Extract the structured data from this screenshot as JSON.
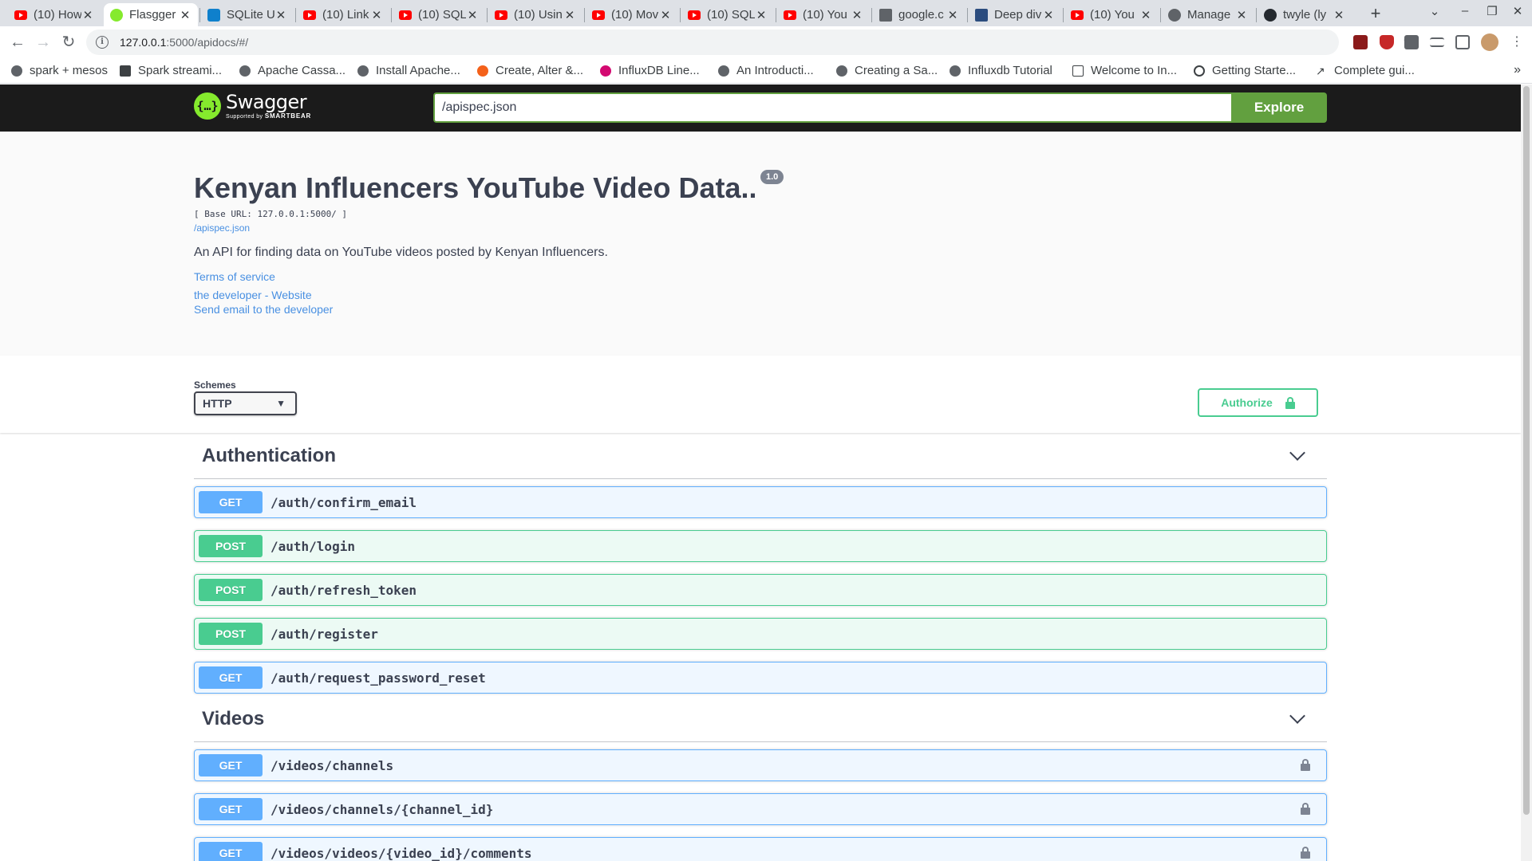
{
  "browser": {
    "tabs": [
      {
        "title": "(10) How",
        "icon": "youtube-icon"
      },
      {
        "title": "Flasgger",
        "icon": "swagger-icon",
        "active": true
      },
      {
        "title": "SQLite U",
        "icon": "sqlite-icon"
      },
      {
        "title": "(10) Link",
        "icon": "youtube-icon"
      },
      {
        "title": "(10) SQL",
        "icon": "youtube-icon"
      },
      {
        "title": "(10) Usin",
        "icon": "youtube-icon"
      },
      {
        "title": "(10) Mov",
        "icon": "youtube-icon"
      },
      {
        "title": "(10) SQL",
        "icon": "youtube-icon"
      },
      {
        "title": "(10) You",
        "icon": "youtube-icon"
      },
      {
        "title": "google.c",
        "icon": "document-icon"
      },
      {
        "title": "Deep div",
        "icon": "tds-icon"
      },
      {
        "title": "(10) You",
        "icon": "youtube-icon"
      },
      {
        "title": "Manage",
        "icon": "gear-icon"
      },
      {
        "title": "twyle (ly",
        "icon": "github-icon"
      }
    ],
    "url_host": "127.0.0.1",
    "url_path": ":5000/apidocs/#/",
    "bookmarks": [
      {
        "label": "spark + mesos",
        "icon": "globe-icon"
      },
      {
        "label": "Spark streami...",
        "icon": "medium-icon"
      },
      {
        "label": "Apache Cassa...",
        "icon": "globe-icon"
      },
      {
        "label": "Install Apache...",
        "icon": "globe-icon"
      },
      {
        "label": "Create, Alter &...",
        "icon": "orange-icon"
      },
      {
        "label": "InfluxDB Line...",
        "icon": "influxdb-icon"
      },
      {
        "label": "An Introducti...",
        "icon": "globe-icon"
      },
      {
        "label": "Creating a Sa...",
        "icon": "globe-icon"
      },
      {
        "label": "Influxdb Tutorial",
        "icon": "globe-icon"
      },
      {
        "label": "Welcome to In...",
        "icon": "document-icon"
      },
      {
        "label": "Getting Starte...",
        "icon": "outline-icon"
      },
      {
        "label": "Complete gui...",
        "icon": "chart-line-icon"
      }
    ],
    "more_label": "»"
  },
  "swagger": {
    "logo_text": "Swagger",
    "logo_supported": "Supported by",
    "logo_brand": "SMARTBEAR",
    "spec_url": "/apispec.json",
    "explore_label": "Explore",
    "colors": {
      "topbar": "#1b1b1b",
      "accent": "#62a03f",
      "get": "#61affe",
      "post": "#49cc90"
    }
  },
  "info": {
    "title": "Kenyan Influencers YouTube Video Data..",
    "version": "1.0",
    "base_url": "[ Base URL: 127.0.0.1:5000/ ]",
    "spec_link": "/apispec.json",
    "description": "An API for finding data on YouTube videos posted by Kenyan Influencers.",
    "terms_link": "Terms of service",
    "developer_link": "the developer - Website",
    "email_link": "Send email to the developer"
  },
  "schemes": {
    "label": "Schemes",
    "selected": "HTTP",
    "authorize_label": "Authorize"
  },
  "tags": [
    {
      "name": "Authentication",
      "operations": [
        {
          "method": "GET",
          "path": "/auth/confirm_email",
          "locked": false
        },
        {
          "method": "POST",
          "path": "/auth/login",
          "locked": false
        },
        {
          "method": "POST",
          "path": "/auth/refresh_token",
          "locked": false
        },
        {
          "method": "POST",
          "path": "/auth/register",
          "locked": false
        },
        {
          "method": "GET",
          "path": "/auth/request_password_reset",
          "locked": false
        }
      ]
    },
    {
      "name": "Videos",
      "operations": [
        {
          "method": "GET",
          "path": "/videos/channels",
          "locked": true
        },
        {
          "method": "GET",
          "path": "/videos/channels/{channel_id}",
          "locked": true
        },
        {
          "method": "GET",
          "path": "/videos/videos/{video_id}/comments",
          "locked": true
        }
      ]
    }
  ]
}
